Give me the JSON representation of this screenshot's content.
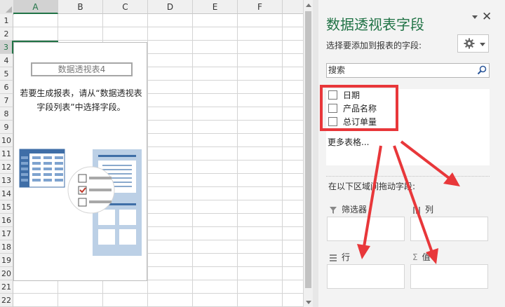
{
  "spreadsheet": {
    "columns": [
      "A",
      "B",
      "C",
      "D",
      "E",
      "F"
    ],
    "rows": [
      "1",
      "2",
      "3",
      "4",
      "5",
      "6",
      "7",
      "8",
      "9",
      "10",
      "11",
      "12",
      "13",
      "14",
      "15",
      "16",
      "17",
      "18",
      "19",
      "20",
      "21",
      "22"
    ],
    "selected_column": "A",
    "selected_row": "3"
  },
  "pivot_placeholder": {
    "title": "数据透视表4",
    "message_line1": "若要生成报表，请从“数据透视表",
    "message_line2": "字段列表”中选择字段。"
  },
  "field_pane": {
    "title": "数据透视表字段",
    "subtitle": "选择要添加到报表的字段:",
    "search_placeholder": "搜索",
    "fields": [
      {
        "label": "日期",
        "checked": false
      },
      {
        "label": "产品名称",
        "checked": false
      },
      {
        "label": "总订单量",
        "checked": false
      }
    ],
    "more_tables": "更多表格...",
    "drag_label": "在以下区域间拖动字段:",
    "areas": {
      "filters": "筛选器",
      "columns": "列",
      "rows": "行",
      "values": "值"
    }
  },
  "colors": {
    "accent_green": "#217346",
    "annotation_red": "#e8373a",
    "pane_bg": "#f3f3f3"
  }
}
